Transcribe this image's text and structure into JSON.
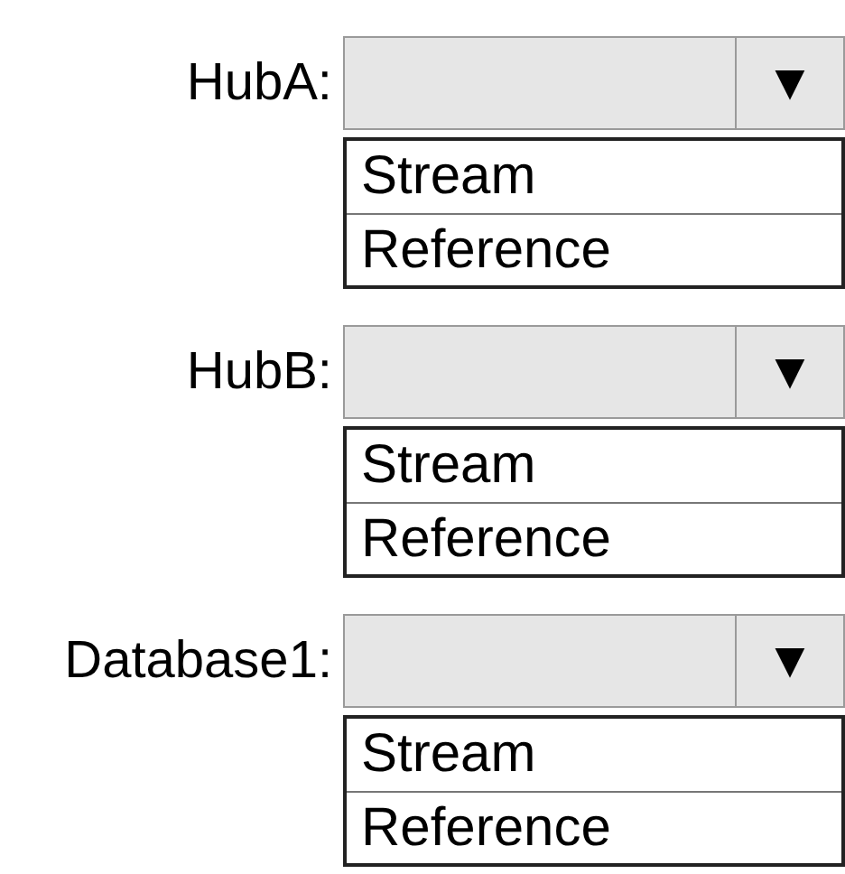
{
  "fields": [
    {
      "label": "HubA:",
      "arrow": "▼",
      "options": [
        "Stream",
        "Reference"
      ]
    },
    {
      "label": "HubB:",
      "arrow": "▼",
      "options": [
        "Stream",
        "Reference"
      ]
    },
    {
      "label": "Database1:",
      "arrow": "▼",
      "options": [
        "Stream",
        "Reference"
      ]
    }
  ]
}
